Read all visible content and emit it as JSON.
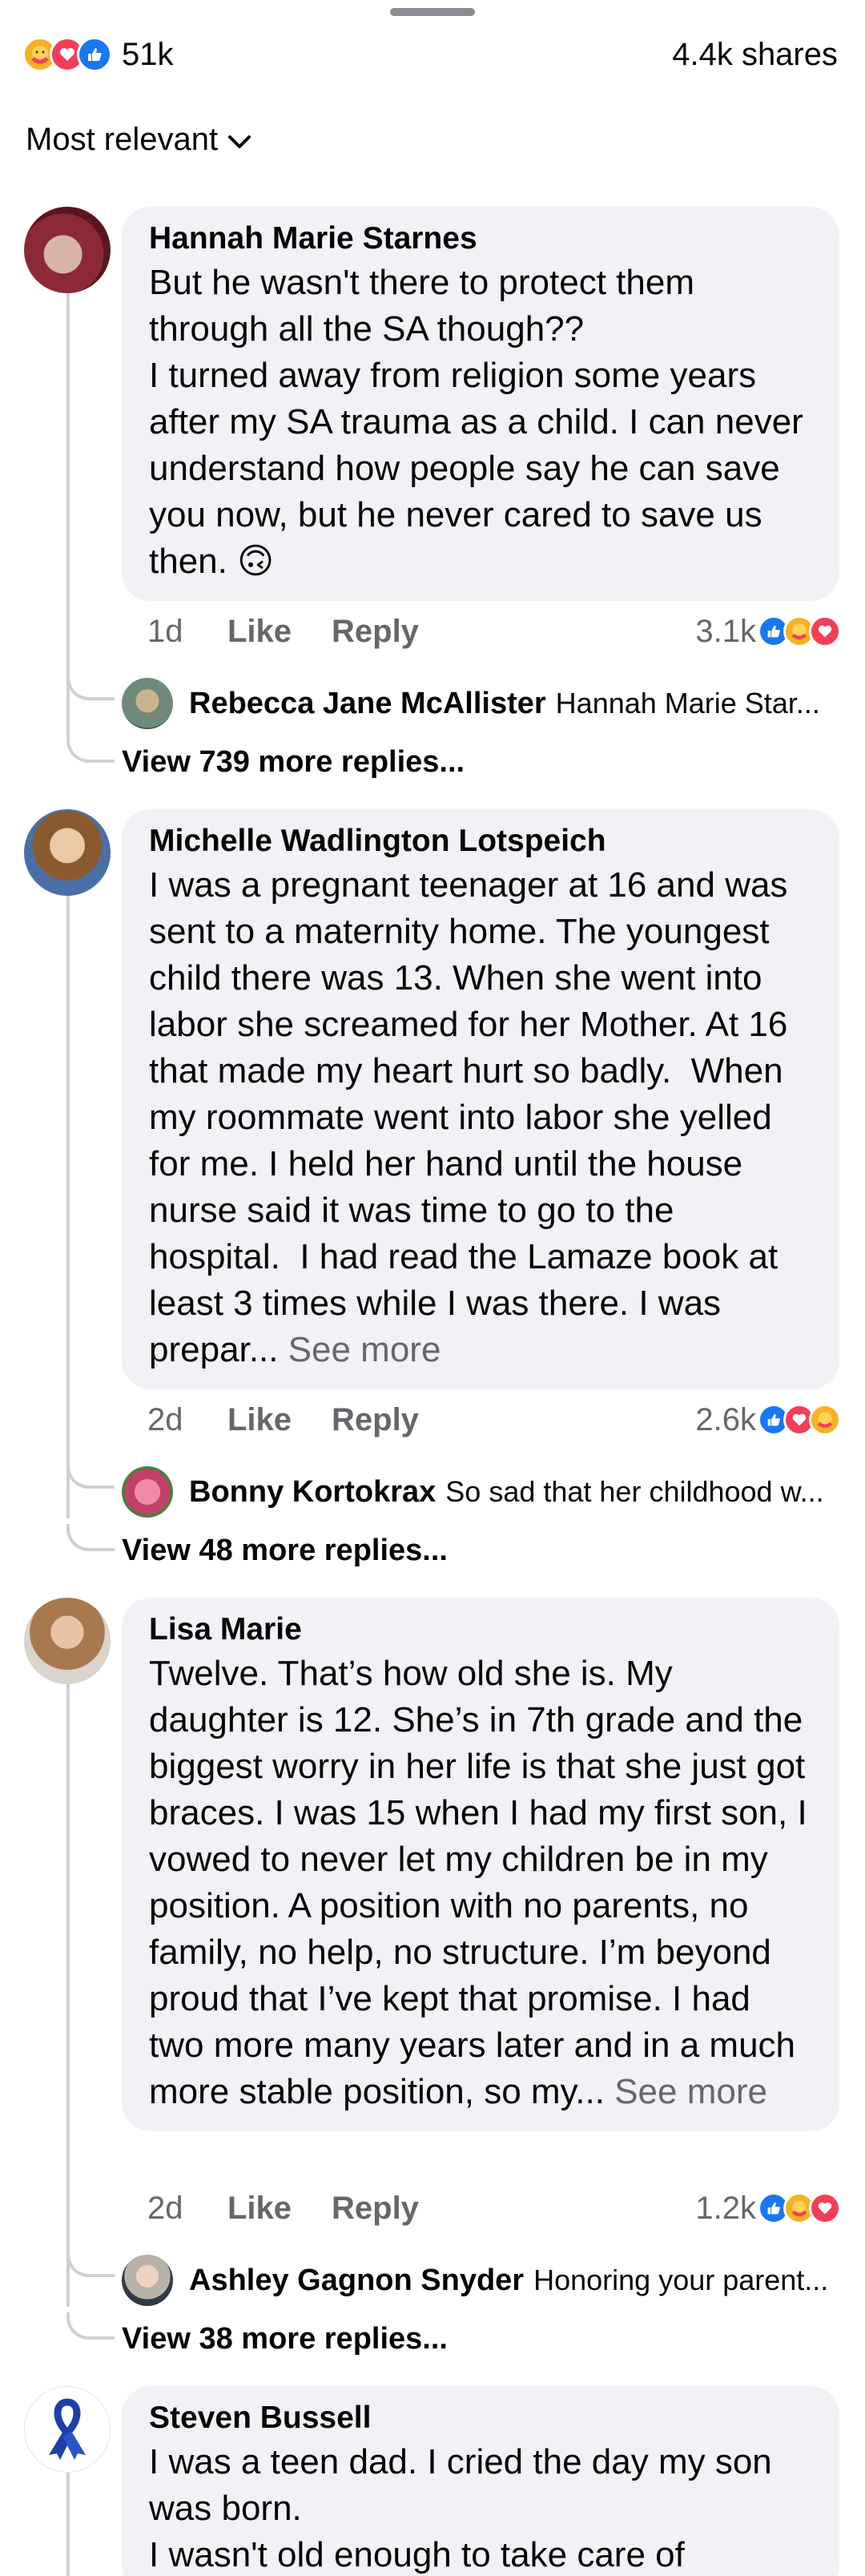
{
  "header": {
    "reaction_count": "51k",
    "shares": "4.4k shares",
    "reaction_icons": [
      "care-icon",
      "love-icon",
      "like-icon"
    ]
  },
  "sort": {
    "label": "Most relevant"
  },
  "comments": [
    {
      "author": "Hannah Marie Starnes",
      "text": "But he wasn't there to protect them through all the SA though??\nI turned away from religion some years after my SA trauma as a child. I can never understand how people say he can save you now, but he never cared to save us then. 🙃",
      "see_more": "",
      "time": "1d",
      "like": "Like",
      "reply": "Reply",
      "reaction_count": "3.1k",
      "reply_preview": {
        "name": "Rebecca Jane McAllister",
        "snippet": "Hannah Marie Star..."
      },
      "view_more": "View 739 more replies..."
    },
    {
      "author": "Michelle Wadlington Lotspeich",
      "text": "I was a pregnant teenager at 16 and was sent to a maternity home. The youngest child there was 13. When she went into labor she screamed for her Mother. At 16 that made my heart hurt so badly.  When my roommate went into labor she yelled for me. I held her hand until the house nurse said it was time to go to the hospital.  I had read the Lamaze book at least 3 times while I was there. I was prepar... ",
      "see_more": "See more",
      "time": "2d",
      "like": "Like",
      "reply": "Reply",
      "reaction_count": "2.6k",
      "reply_preview": {
        "name": "Bonny Kortokrax",
        "snippet": "So sad that her childhood w..."
      },
      "view_more": "View 48 more replies..."
    },
    {
      "author": "Lisa Marie",
      "text": "Twelve. That’s how old she is. My daughter is 12. She’s in 7th grade and the biggest worry in her life is that she just got braces. I was 15 when I had my first son, I vowed to never let my children be in my position. A position with no parents, no family, no help, no structure. I’m beyond proud that I’ve kept that promise. I had two more many years later and in a much more stable position, so my... ",
      "see_more": "See more",
      "time": "2d",
      "like": "Like",
      "reply": "Reply",
      "reaction_count": "1.2k",
      "reply_preview": {
        "name": "Ashley Gagnon Snyder",
        "snippet": "Honoring your parent..."
      },
      "view_more": "View 38 more replies..."
    },
    {
      "author": "Steven Bussell",
      "text": "I was a teen dad. I cried the day my son was born.\nI wasn't old enough to take care of",
      "see_more": ""
    }
  ],
  "colors": {
    "like": "#1877f2",
    "love": "#f33e58",
    "care": "#f7b125",
    "bubble": "#f0f2f5",
    "meta": "#65676b"
  }
}
